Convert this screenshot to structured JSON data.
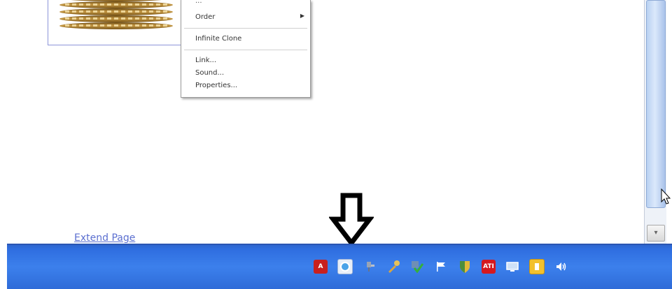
{
  "context_menu": {
    "partial_label": "...",
    "items": [
      "Order",
      "Infinite Clone",
      "Link...",
      "Sound...",
      "Properties..."
    ]
  },
  "page": {
    "extend_link": "Extend Page"
  },
  "icons": {
    "tray": [
      "adobe-reader-icon",
      "disc-icon",
      "network-plug-icon",
      "tools-icon",
      "security-check-icon",
      "flag-icon",
      "shield-icon",
      "ati-icon",
      "display-icon",
      "yellow-app-icon",
      "volume-icon"
    ],
    "tray_ati_text": "ATI",
    "tray_adobe_text": "A"
  },
  "colors": {
    "taskbar": "#2f6ee0",
    "link": "#5b6fd0",
    "selection_border": "#8c94d8"
  }
}
